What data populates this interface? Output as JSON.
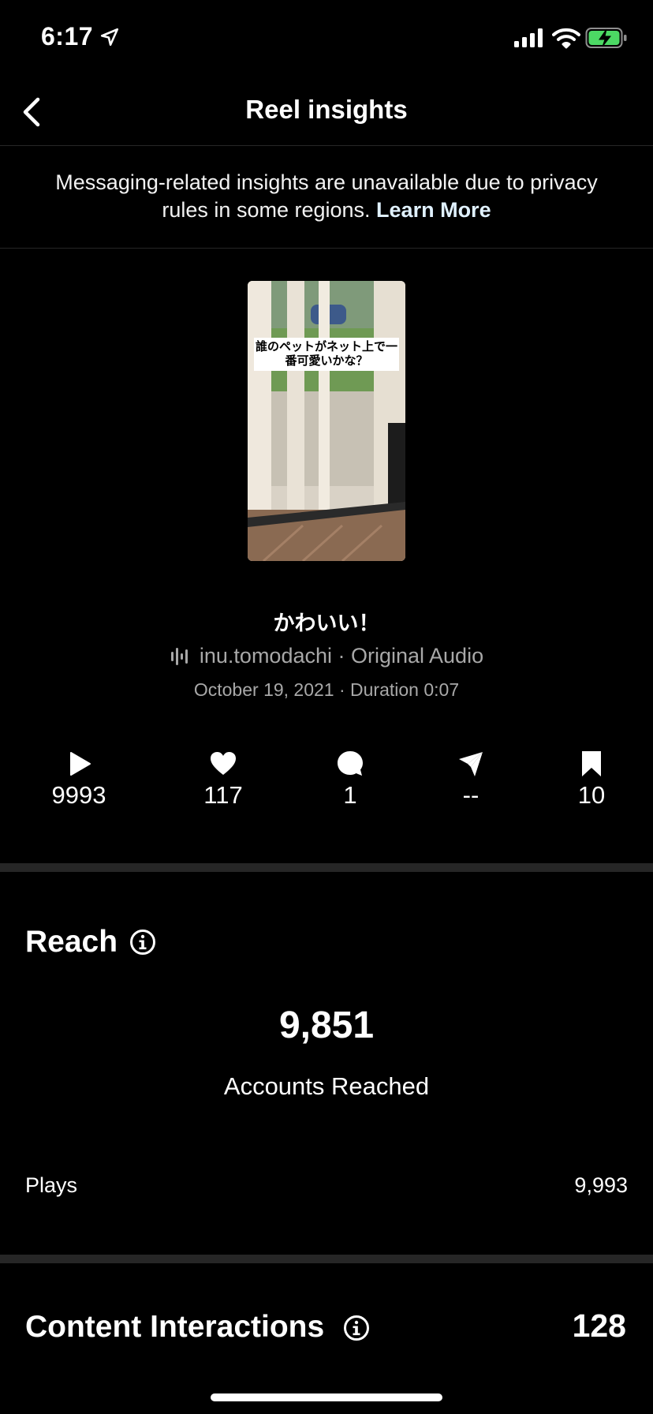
{
  "status_bar": {
    "time": "6:17"
  },
  "nav": {
    "title": "Reel insights"
  },
  "notice": {
    "text": "Messaging-related insights are unavailable due to privacy rules in some regions.",
    "link": "Learn More"
  },
  "thumbnail": {
    "caption": "誰のペットがネット上で一番可愛いかな？"
  },
  "reel": {
    "title": "かわいい！",
    "audio": "inu.tomodachi · Original Audio",
    "date_duration": "October 19, 2021 · Duration 0:07"
  },
  "stats": {
    "plays": "9993",
    "likes": "117",
    "comments": "1",
    "shares": "--",
    "saves": "10"
  },
  "reach": {
    "title": "Reach",
    "accounts_reached": "9,851",
    "accounts_reached_label": "Accounts Reached",
    "plays_label": "Plays",
    "plays_value": "9,993"
  },
  "content_interactions": {
    "title": "Content Interactions",
    "value": "128"
  },
  "icons": {
    "back": "chevron-left-icon",
    "play": "play-icon",
    "like": "heart-icon",
    "comment": "comment-bubble-icon",
    "share": "send-icon",
    "save": "bookmark-icon",
    "info": "info-icon",
    "audio": "audio-waveform-icon"
  },
  "colors": {
    "background": "#000000",
    "text": "#ffffff",
    "muted": "#a8a8a8",
    "divider": "#262626",
    "battery": "#4cd964"
  }
}
